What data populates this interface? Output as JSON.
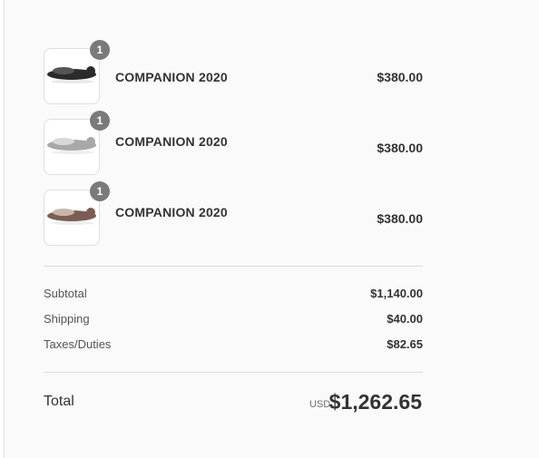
{
  "order_summary": {
    "items": [
      {
        "quantity": "1",
        "name": "COMPANION 2020",
        "price": "$380.00",
        "image_icon": "figure-lying-black-thumbnail",
        "colors": {
          "body": "#2b2b2b",
          "accent": "#555555"
        }
      },
      {
        "quantity": "1",
        "name": "COMPANION 2020",
        "price": "$380.00",
        "image_icon": "figure-lying-grey-thumbnail",
        "colors": {
          "body": "#a8a8a8",
          "accent": "#d8d8d8"
        }
      },
      {
        "quantity": "1",
        "name": "COMPANION 2020",
        "price": "$380.00",
        "image_icon": "figure-lying-brown-thumbnail",
        "colors": {
          "body": "#7a5e55",
          "accent": "#c9b6aa"
        }
      }
    ],
    "subtotal": {
      "label": "Subtotal",
      "value": "$1,140.00"
    },
    "shipping": {
      "label": "Shipping",
      "value": "$40.00"
    },
    "taxes": {
      "label": "Taxes/Duties",
      "value": "$82.65"
    },
    "total": {
      "label": "Total",
      "currency": "USD",
      "amount": "$1,262.65"
    }
  }
}
